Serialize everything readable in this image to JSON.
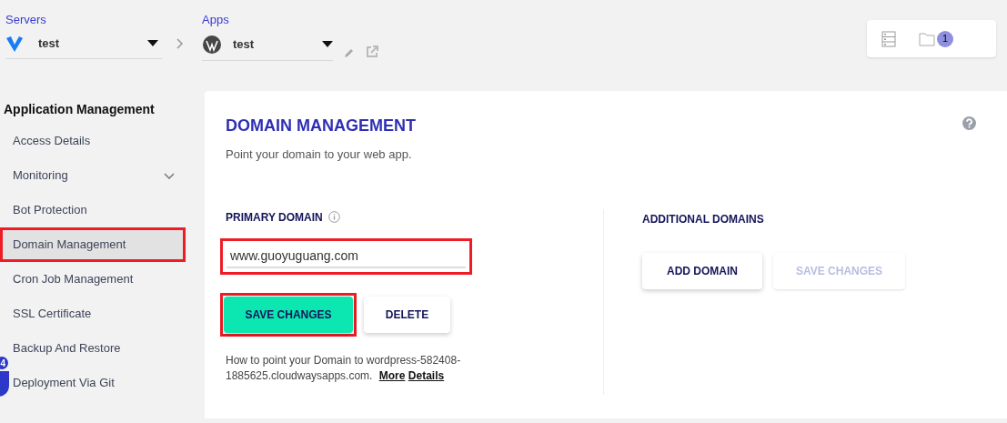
{
  "breadcrumb": {
    "servers": {
      "label": "Servers",
      "value": "test"
    },
    "apps": {
      "label": "Apps",
      "value": "test"
    }
  },
  "toolbar": {
    "notification_count": "1"
  },
  "sidebar": {
    "heading": "Application Management",
    "items": [
      {
        "label": "Access Details",
        "selected": false,
        "expandable": false,
        "highlighted": false
      },
      {
        "label": "Monitoring",
        "selected": false,
        "expandable": true,
        "highlighted": false
      },
      {
        "label": "Bot Protection",
        "selected": false,
        "expandable": false,
        "highlighted": false
      },
      {
        "label": "Domain Management",
        "selected": true,
        "expandable": false,
        "highlighted": true
      },
      {
        "label": "Cron Job Management",
        "selected": false,
        "expandable": false,
        "highlighted": false
      },
      {
        "label": "SSL Certificate",
        "selected": false,
        "expandable": false,
        "highlighted": false
      },
      {
        "label": "Backup And Restore",
        "selected": false,
        "expandable": false,
        "highlighted": false
      },
      {
        "label": "Deployment Via Git",
        "selected": false,
        "expandable": false,
        "highlighted": false
      }
    ]
  },
  "chat_badge": "4",
  "panel": {
    "title": "DOMAIN MANAGEMENT",
    "subtitle": "Point your domain to your web app.",
    "primary": {
      "label": "PRIMARY DOMAIN",
      "value": "www.guoyuguang.com",
      "field_highlighted": true,
      "buttons": [
        {
          "label": "SAVE CHANGES",
          "filled": true,
          "disabled": false,
          "highlighted": true
        },
        {
          "label": "DELETE",
          "filled": false,
          "disabled": false,
          "highlighted": false
        }
      ],
      "help_text": "How to point your Domain to wordpress-582408-1885625.cloudwaysapps.com.",
      "help_link_1": "More",
      "help_link_2": "Details"
    },
    "additional": {
      "label": "ADDITIONAL DOMAINS",
      "buttons": [
        {
          "label": "ADD DOMAIN",
          "disabled": false
        },
        {
          "label": "SAVE CHANGES",
          "disabled": true
        }
      ]
    }
  }
}
